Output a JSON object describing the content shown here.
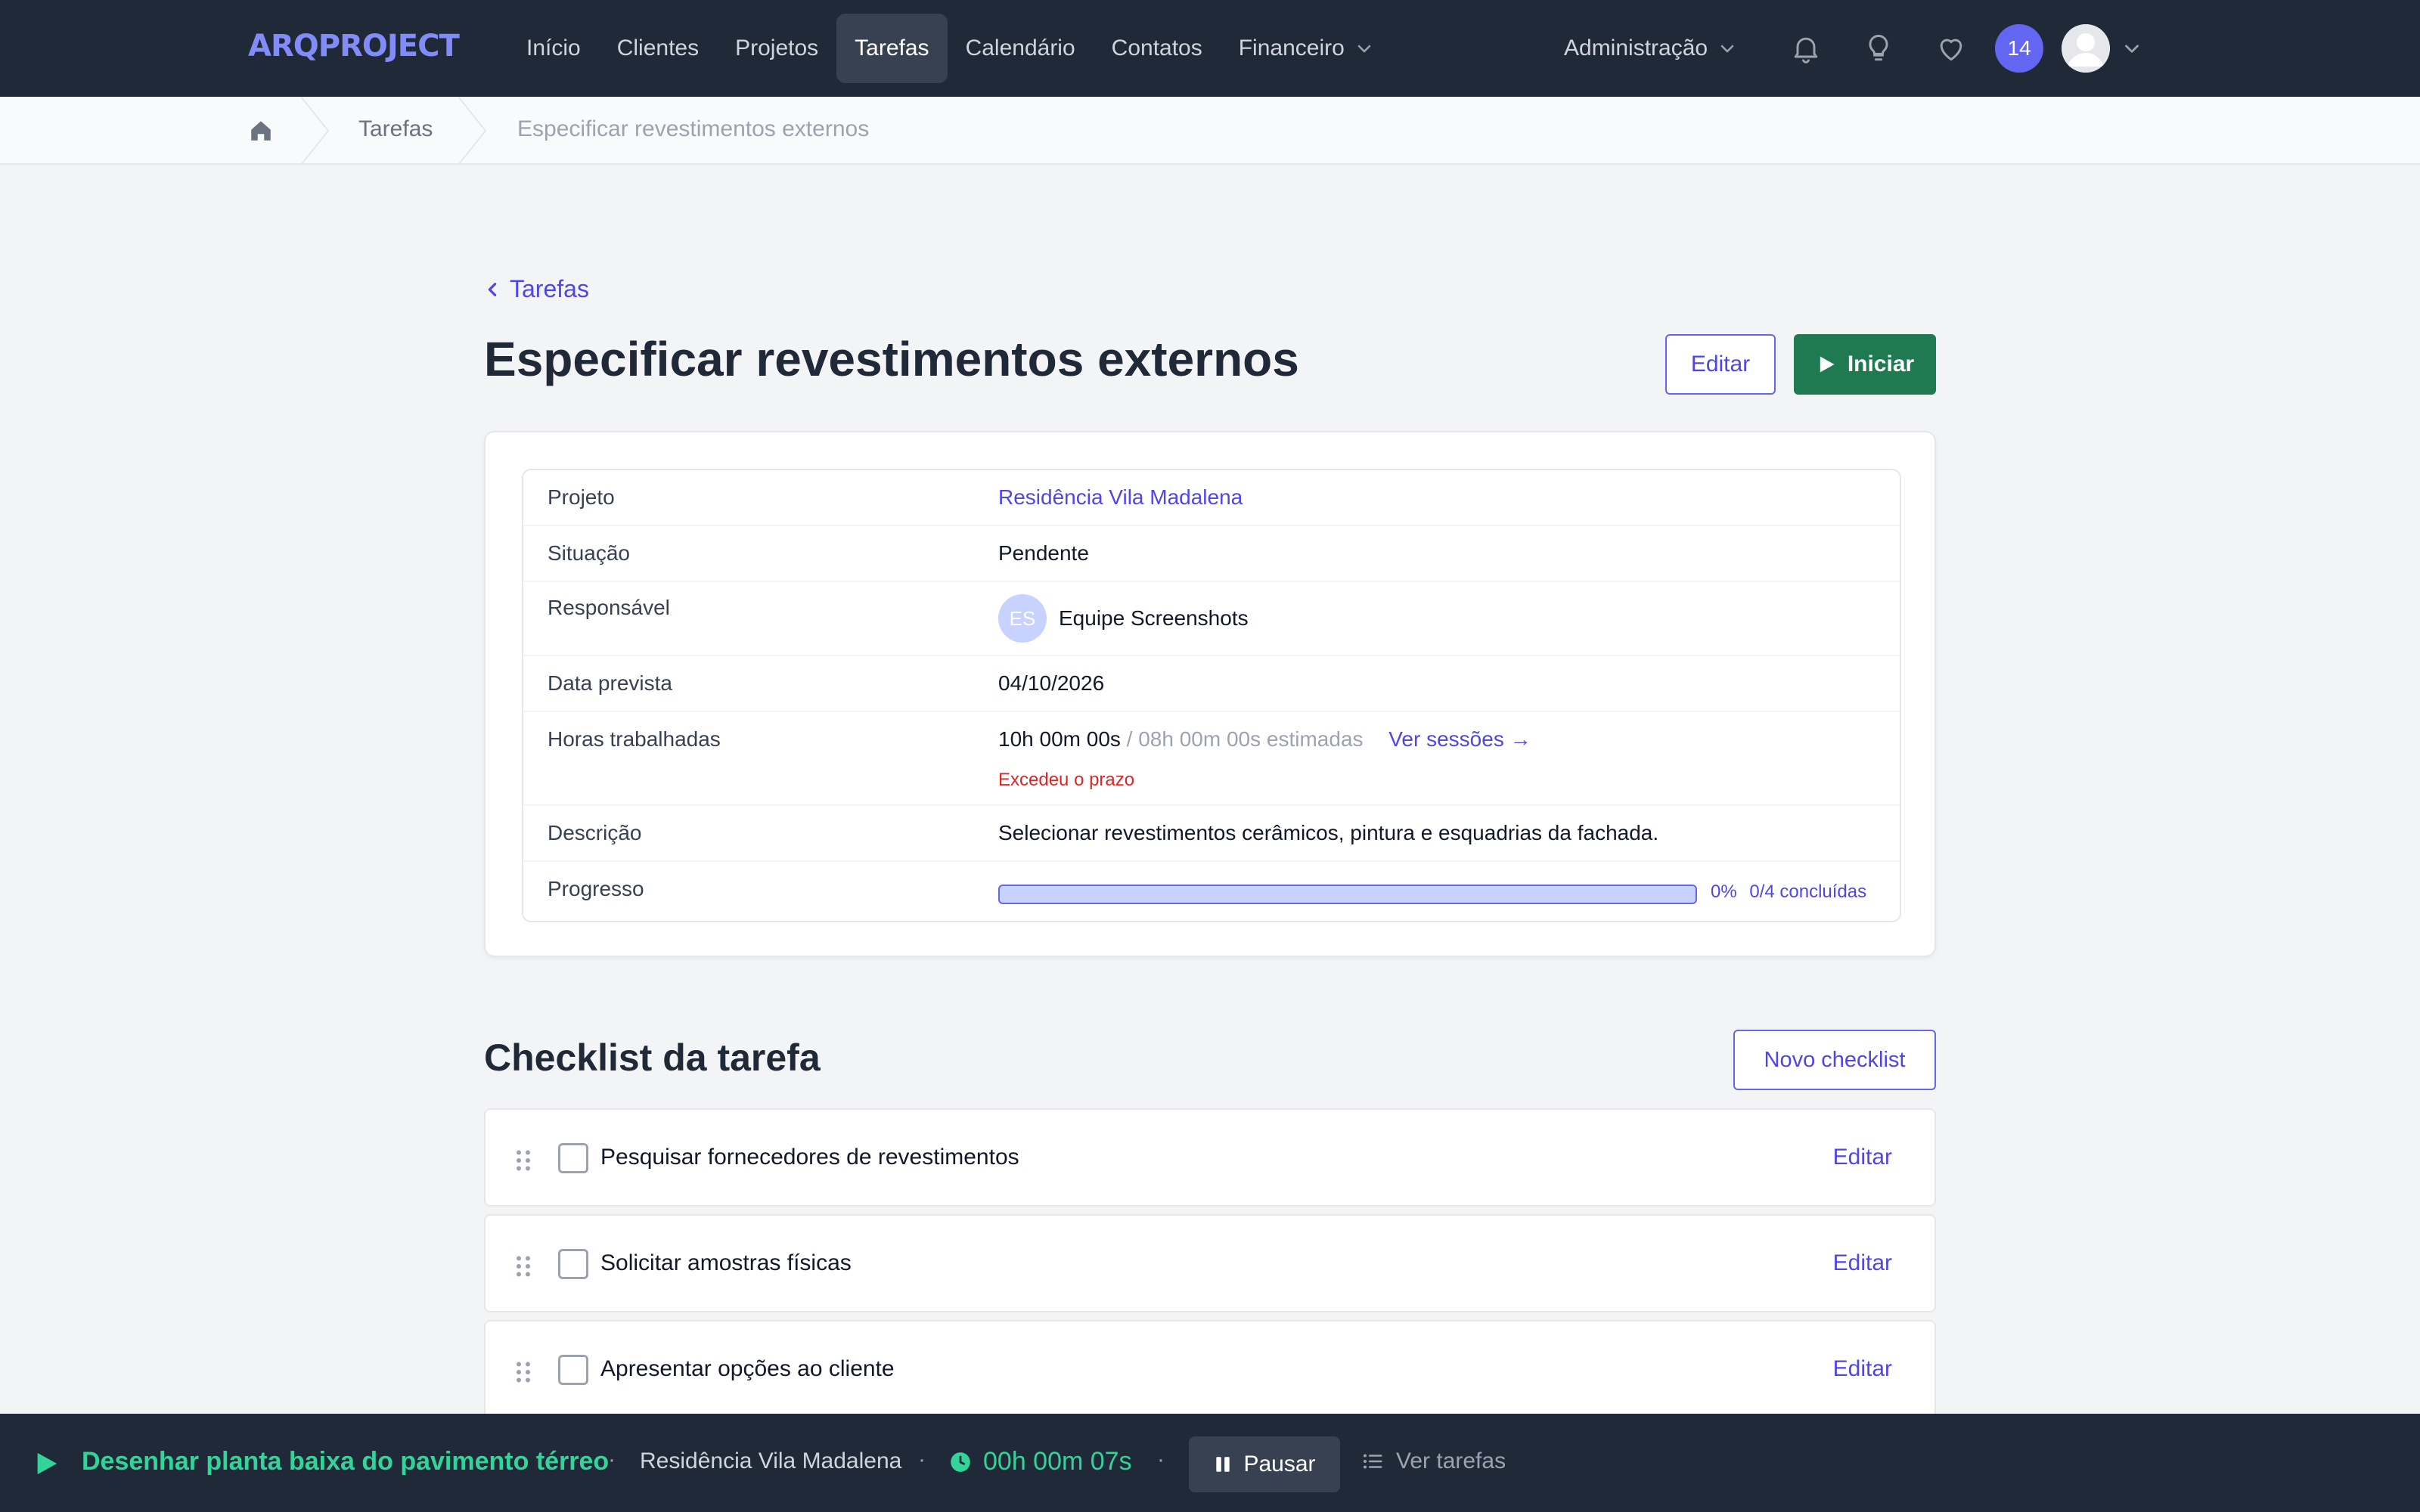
{
  "app": {
    "logo": "ARQPROJECT"
  },
  "nav": {
    "items": [
      {
        "label": "Início"
      },
      {
        "label": "Clientes"
      },
      {
        "label": "Projetos"
      },
      {
        "label": "Tarefas",
        "active": true
      },
      {
        "label": "Calendário"
      },
      {
        "label": "Contatos"
      },
      {
        "label": "Financeiro",
        "dropdown": true
      }
    ],
    "admin_label": "Administração",
    "notification_count": "14",
    "icons": [
      "bell-icon",
      "lightbulb-icon",
      "heart-icon",
      "user-avatar",
      "chevron-down-icon"
    ]
  },
  "breadcrumb": {
    "home_icon": "home-icon",
    "items": [
      "Tarefas",
      "Especificar revestimentos externos"
    ]
  },
  "page": {
    "back_label": "Tarefas",
    "title": "Especificar revestimentos externos",
    "edit_label": "Editar",
    "start_label": "Iniciar"
  },
  "details": {
    "project_label": "Projeto",
    "project_value": "Residência Vila Madalena",
    "status_label": "Situação",
    "status_value": "Pendente",
    "assignee_label": "Responsável",
    "assignee_initials": "ES",
    "assignee_value": "Equipe Screenshots",
    "due_label": "Data prevista",
    "due_value": "04/10/2026",
    "hours_label": "Horas trabalhadas",
    "hours_worked": "10h 00m 00s",
    "hours_estimated": "/ 08h 00m 00s estimadas",
    "sessions_link": "Ver sessões →",
    "overdue_warning": "Excedeu o prazo",
    "description_label": "Descrição",
    "description_value": "Selecionar revestimentos cerâmicos, pintura e esquadrias da fachada.",
    "progress_label": "Progresso",
    "progress_percent": 0,
    "progress_percent_text": "0%",
    "progress_count": "0/4 concluídas"
  },
  "checklist": {
    "title": "Checklist da tarefa",
    "new_label": "Novo checklist",
    "edit_label": "Editar",
    "items": [
      {
        "label": "Pesquisar fornecedores de revestimentos",
        "checked": false
      },
      {
        "label": "Solicitar amostras físicas",
        "checked": false
      },
      {
        "label": "Apresentar opções ao cliente",
        "checked": false
      }
    ]
  },
  "timer": {
    "task": "Desenhar planta baixa do pavimento térreo",
    "project": "Residência Vila Madalena",
    "elapsed": "00h 00m 07s",
    "pause_label": "Pausar",
    "list_label": "Ver tarefas",
    "separator": "·"
  },
  "colors": {
    "nav_bg": "#1f2937",
    "accent": "#4f46e5",
    "start_button": "#1f7a52",
    "timer_green": "#34d399",
    "warning": "#dc2626"
  }
}
